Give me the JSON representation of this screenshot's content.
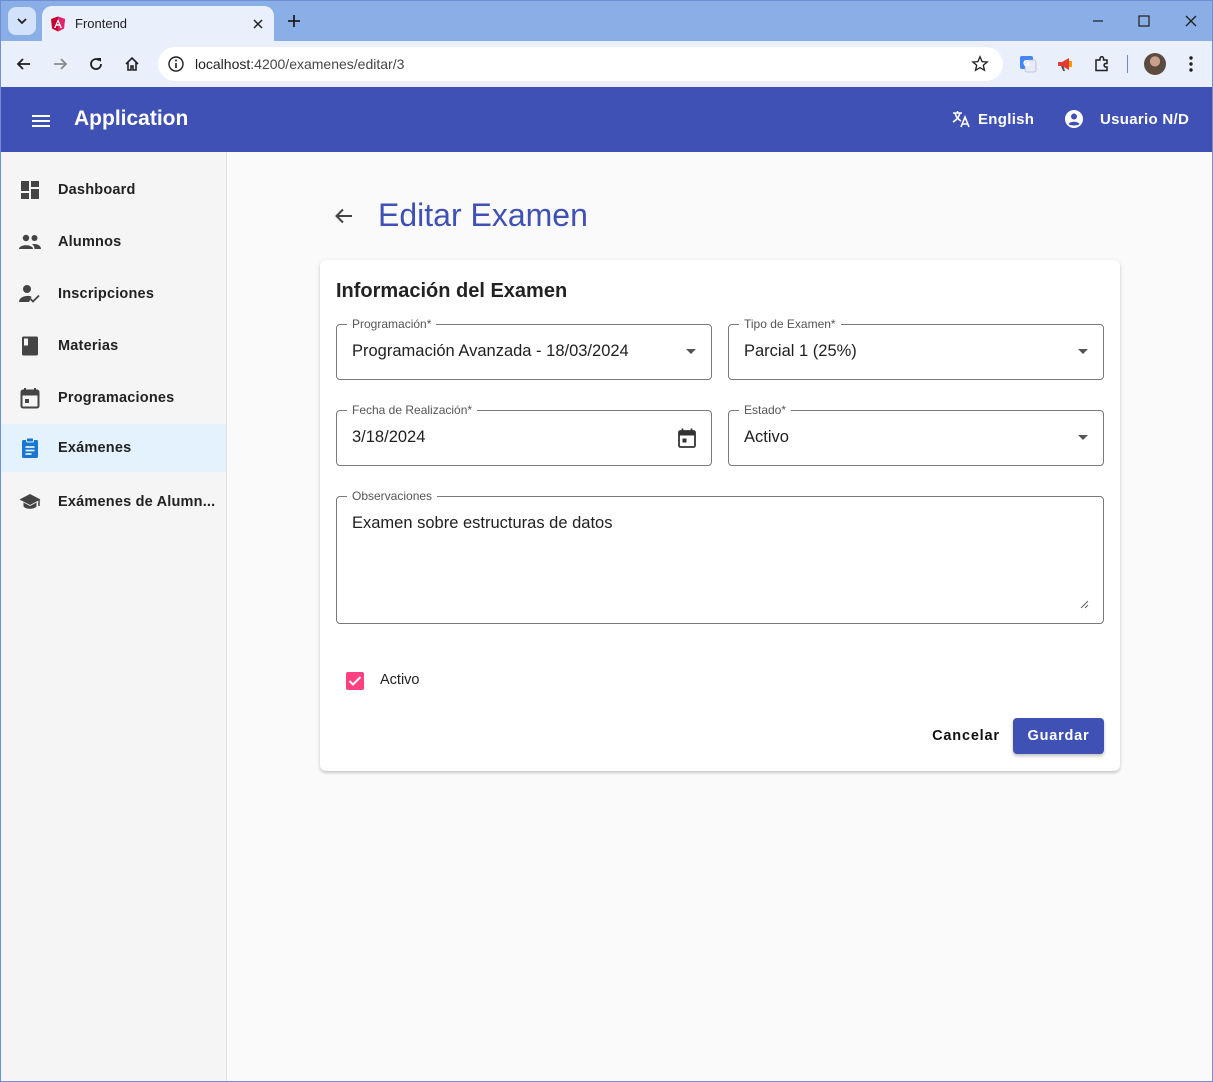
{
  "browser": {
    "tab_title": "Frontend",
    "url_host": "localhost",
    "url_path": ":4200/examenes/editar/3",
    "icons": [
      "tab-search-icon",
      "angular-icon",
      "close-icon",
      "plus-icon",
      "minimize-icon",
      "maximize-icon",
      "close-window-icon",
      "back-icon",
      "forward-icon",
      "reload-icon",
      "home-icon",
      "info-icon",
      "star-icon",
      "translate-extension-icon",
      "megaphone-extension-icon",
      "puzzle-icon",
      "kebab-menu-icon"
    ]
  },
  "header": {
    "app_title": "Application",
    "language": "English",
    "user": "Usuario N/D",
    "color": "#3f51b5"
  },
  "sidebar": {
    "items": [
      {
        "label": "Dashboard",
        "icon": "dashboard-icon",
        "active": false
      },
      {
        "label": "Alumnos",
        "icon": "people-icon",
        "active": false
      },
      {
        "label": "Inscripciones",
        "icon": "how-to-reg-icon",
        "active": false
      },
      {
        "label": "Materias",
        "icon": "book-icon",
        "active": false
      },
      {
        "label": "Programaciones",
        "icon": "calendar-icon",
        "active": false
      },
      {
        "label": "Exámenes",
        "icon": "assignment-icon",
        "active": true
      },
      {
        "label": "Exámenes de Alumn...",
        "icon": "school-icon",
        "active": false
      }
    ]
  },
  "page": {
    "title": "Editar Examen"
  },
  "form": {
    "card_title": "Información del Examen",
    "programacion": {
      "label": "Programación*",
      "value": "Programación Avanzada - 18/03/2024"
    },
    "tipo_examen": {
      "label": "Tipo de Examen*",
      "value": "Parcial 1 (25%)"
    },
    "fecha": {
      "label": "Fecha de Realización*",
      "value": "3/18/2024"
    },
    "estado": {
      "label": "Estado*",
      "value": "Activo"
    },
    "observaciones": {
      "label": "Observaciones",
      "value": "Examen sobre estructuras de datos"
    },
    "activo": {
      "label": "Activo",
      "checked": true,
      "color": "#ff4081"
    },
    "cancel_label": "Cancelar",
    "save_label": "Guardar"
  }
}
